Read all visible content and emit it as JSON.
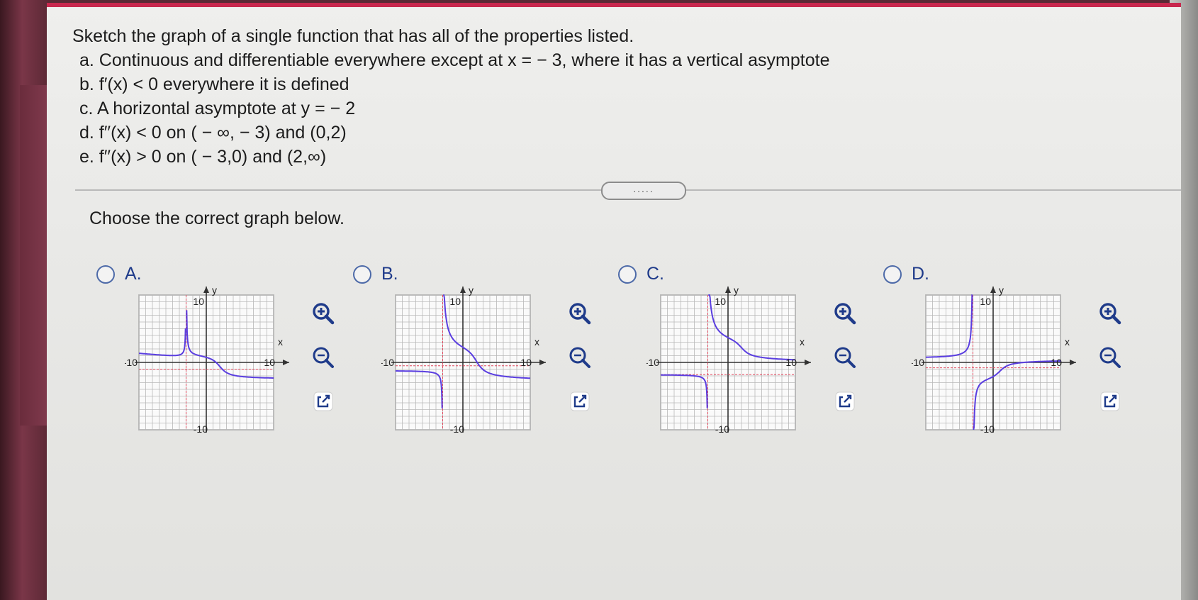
{
  "question": {
    "title": "Sketch the graph of a single function that has all of the properties listed.",
    "items": [
      "a. Continuous and differentiable everywhere except at x = − 3, where it has a vertical asymptote",
      "b. f′(x) < 0 everywhere it is defined",
      "c. A horizontal asymptote at y = − 2",
      "d. f′′(x) < 0 on ( − ∞, − 3) and (0,2)",
      "e. f′′(x) > 0 on ( − 3,0) and (2,∞)"
    ]
  },
  "expand_label": ".....",
  "prompt": "Choose the correct graph below.",
  "options": [
    {
      "label": "A."
    },
    {
      "label": "B."
    },
    {
      "label": "C."
    },
    {
      "label": "D."
    }
  ],
  "graph_labels": {
    "y_axis": "y",
    "x_axis": "x",
    "top": "10",
    "bottom": "-10",
    "left": "-10",
    "right": "10"
  },
  "colors": {
    "accent": "#c8284e",
    "curve": "#5a3ee0",
    "asymptote": "#e0455a",
    "link": "#1f3b8a"
  },
  "icons": [
    "zoom-in-icon",
    "zoom-out-icon",
    "external-link-icon"
  ]
}
